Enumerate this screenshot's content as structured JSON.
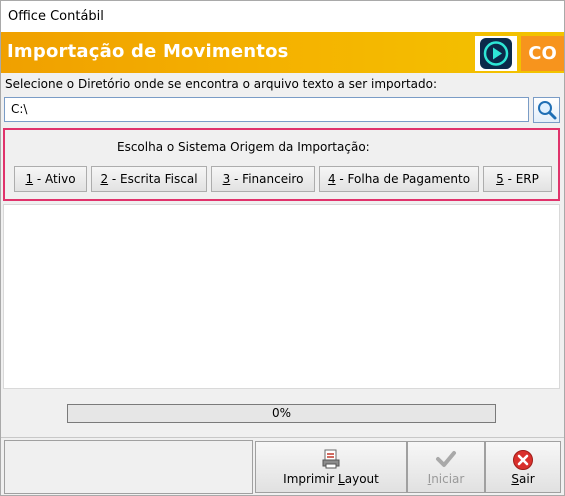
{
  "window": {
    "title": "Office Contábil"
  },
  "banner": {
    "heading": "Importação de Movimentos",
    "logo_text": "CO",
    "logo_icon": "play-icon"
  },
  "directory": {
    "label": "Selecione o Diretório onde se encontra o arquivo texto a ser importado:",
    "value": "C:\\",
    "search_icon": "search-icon"
  },
  "origin": {
    "label": "Escolha o Sistema Origem da  Importação:",
    "buttons": [
      {
        "key": "1",
        "text": " - Ativo"
      },
      {
        "key": "2",
        "text": " - Escrita Fiscal"
      },
      {
        "key": "3",
        "text": " - Financeiro"
      },
      {
        "key": "4",
        "text": " - Folha de Pagamento"
      },
      {
        "key": "5",
        "text": " - ERP"
      }
    ]
  },
  "progress": {
    "value": 0,
    "text": "0%"
  },
  "footer": {
    "print_layout": {
      "prefix": "Imprimir ",
      "key": "L",
      "suffix": "ayout",
      "icon": "print-document-icon"
    },
    "start": {
      "key": "I",
      "suffix": "niciar",
      "icon": "checkmark-icon",
      "enabled": false
    },
    "exit": {
      "key": "S",
      "suffix": "air",
      "icon": "close-icon"
    }
  },
  "colors": {
    "banner": "#f5b400",
    "accent": "#e0336b",
    "logo": "#f7941d"
  }
}
